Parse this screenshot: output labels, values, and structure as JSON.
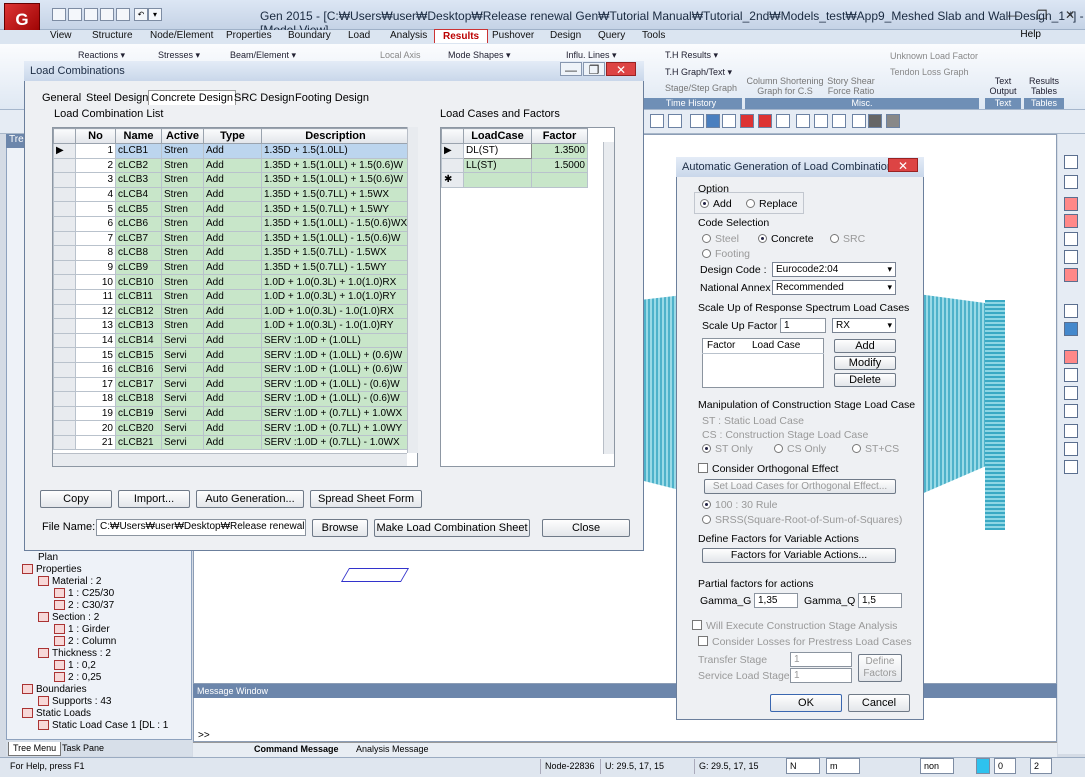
{
  "window": {
    "title": "Gen 2015 - [C:₩Users₩user₩Desktop₩Release renewal Gen₩Tutorial Manual₩Tutorial_2nd₩Models_test₩App9_Meshed Slab and Wall Design_1 *] - [Model View]",
    "logo": "G"
  },
  "menu": {
    "tabs": [
      "View",
      "Structure",
      "Node/Element",
      "Properties",
      "Boundary",
      "Load",
      "Analysis",
      "Results",
      "Pushover",
      "Design",
      "Query",
      "Tools"
    ],
    "active": "Results",
    "help": "Help"
  },
  "ribbon": {
    "reactions": "Reactions",
    "stresses": "Stresses",
    "beam_element": "Beam/Element",
    "local_axis": "Local Axis",
    "mode_shapes": "Mode Shapes",
    "influ_lines": "Influ. Lines",
    "th_results": "T.H Results",
    "th_graph": "T.H Graph/Text",
    "stage_step": "Stage/Step Graph",
    "time_history": "Time History",
    "column_shortening": "Column Shortening Graph for C.S",
    "story_shear": "Story Shear Force Ratio",
    "unknown_load": "Unknown Load Factor",
    "tendon_loss": "Tendon Loss Graph",
    "misc": "Misc.",
    "text_output": "Text Output",
    "text_group": "Text",
    "results_tables": "Results Tables",
    "tables_group": "Tables"
  },
  "tree": {
    "header": "Tree",
    "items": [
      {
        "label": "Plan",
        "indent": 2
      },
      {
        "label": "Properties",
        "indent": 1
      },
      {
        "label": "Material : 2",
        "indent": 2
      },
      {
        "label": "1 : C25/30",
        "indent": 3
      },
      {
        "label": "2 : C30/37",
        "indent": 3
      },
      {
        "label": "Section : 2",
        "indent": 2
      },
      {
        "label": "1 : Girder",
        "indent": 3
      },
      {
        "label": "2 : Column",
        "indent": 3
      },
      {
        "label": "Thickness : 2",
        "indent": 2
      },
      {
        "label": "1 : 0,2",
        "indent": 3
      },
      {
        "label": "2 : 0,25",
        "indent": 3
      },
      {
        "label": "Boundaries",
        "indent": 1
      },
      {
        "label": "Supports : 43",
        "indent": 2
      },
      {
        "label": "Static Loads",
        "indent": 1
      },
      {
        "label": "Static Load Case 1 [DL : 1",
        "indent": 2
      }
    ],
    "tabs": [
      "Tree Menu",
      "Task Pane"
    ]
  },
  "load_combinations": {
    "title": "Load Combinations",
    "tabs": [
      "General",
      "Steel Design",
      "Concrete Design",
      "SRC Design",
      "Footing Design"
    ],
    "active_tab": "Concrete Design",
    "list_label": "Load Combination List",
    "columns": [
      "No",
      "Name",
      "Active",
      "Type",
      "Description"
    ],
    "rows": [
      [
        "1",
        "cLCB1",
        "Stren",
        "Add",
        "1.35D + 1.5(1.0LL)"
      ],
      [
        "2",
        "cLCB2",
        "Stren",
        "Add",
        "1.35D + 1.5(1.0LL) + 1.5(0.6)W"
      ],
      [
        "3",
        "cLCB3",
        "Stren",
        "Add",
        "1.35D + 1.5(1.0LL) + 1.5(0.6)W"
      ],
      [
        "4",
        "cLCB4",
        "Stren",
        "Add",
        "1.35D + 1.5(0.7LL) + 1.5WX"
      ],
      [
        "5",
        "cLCB5",
        "Stren",
        "Add",
        "1.35D + 1.5(0.7LL) + 1.5WY"
      ],
      [
        "6",
        "cLCB6",
        "Stren",
        "Add",
        "1.35D + 1.5(1.0LL) - 1.5(0.6)WX"
      ],
      [
        "7",
        "cLCB7",
        "Stren",
        "Add",
        "1.35D + 1.5(1.0LL) - 1.5(0.6)W"
      ],
      [
        "8",
        "cLCB8",
        "Stren",
        "Add",
        "1.35D + 1.5(0.7LL) - 1.5WX"
      ],
      [
        "9",
        "cLCB9",
        "Stren",
        "Add",
        "1.35D + 1.5(0.7LL) - 1.5WY"
      ],
      [
        "10",
        "cLCB10",
        "Stren",
        "Add",
        "1.0D + 1.0(0.3L) + 1.0(1.0)RX"
      ],
      [
        "11",
        "cLCB11",
        "Stren",
        "Add",
        "1.0D + 1.0(0.3L) + 1.0(1.0)RY"
      ],
      [
        "12",
        "cLCB12",
        "Stren",
        "Add",
        "1.0D + 1.0(0.3L) - 1.0(1.0)RX"
      ],
      [
        "13",
        "cLCB13",
        "Stren",
        "Add",
        "1.0D + 1.0(0.3L) - 1.0(1.0)RY"
      ],
      [
        "14",
        "cLCB14",
        "Servi",
        "Add",
        "SERV :1.0D + (1.0LL)"
      ],
      [
        "15",
        "cLCB15",
        "Servi",
        "Add",
        "SERV :1.0D + (1.0LL) + (0.6)W"
      ],
      [
        "16",
        "cLCB16",
        "Servi",
        "Add",
        "SERV :1.0D + (1.0LL) + (0.6)W"
      ],
      [
        "17",
        "cLCB17",
        "Servi",
        "Add",
        "SERV :1.0D + (1.0LL) - (0.6)W"
      ],
      [
        "18",
        "cLCB18",
        "Servi",
        "Add",
        "SERV :1.0D + (1.0LL) - (0.6)W"
      ],
      [
        "19",
        "cLCB19",
        "Servi",
        "Add",
        "SERV :1.0D + (0.7LL) + 1.0WX"
      ],
      [
        "20",
        "cLCB20",
        "Servi",
        "Add",
        "SERV :1.0D + (0.7LL) + 1.0WY"
      ],
      [
        "21",
        "cLCB21",
        "Servi",
        "Add",
        "SERV :1.0D + (0.7LL) - 1.0WX"
      ]
    ],
    "cases_label": "Load Cases and Factors",
    "case_columns": [
      "LoadCase",
      "Factor"
    ],
    "cases": [
      [
        "DL(ST)",
        "1.3500"
      ],
      [
        "LL(ST)",
        "1.5000"
      ]
    ],
    "buttons": {
      "copy": "Copy",
      "import": "Import...",
      "auto": "Auto Generation...",
      "spread": "Spread Sheet Form",
      "browse": "Browse",
      "make": "Make Load Combination Sheet",
      "close": "Close"
    },
    "file_label": "File Name:",
    "file_value": "C:₩Users₩user₩Desktop₩Release renewal G"
  },
  "auto_gen": {
    "title": "Automatic Generation of Load Combinations",
    "option_label": "Option",
    "add": "Add",
    "replace": "Replace",
    "code_selection": "Code Selection",
    "steel": "Steel",
    "concrete": "Concrete",
    "src": "SRC",
    "footing": "Footing",
    "design_code_label": "Design Code :",
    "design_code": "Eurocode2:04",
    "national_annex_label": "National Annex :",
    "national_annex": "Recommended",
    "scale_up_label": "Scale Up of Response Spectrum Load Cases",
    "scale_factor_label": "Scale Up Factor :",
    "scale_factor": "1",
    "direction": "RX",
    "factor_col": "Factor",
    "loadcase_col": "Load Case",
    "add_btn": "Add",
    "modify_btn": "Modify",
    "delete_btn": "Delete",
    "manip_label": "Manipulation of Construction Stage Load Case",
    "st_text": "ST : Static Load Case",
    "cs_text": "CS : Construction Stage Load Case",
    "st_only": "ST Only",
    "cs_only": "CS Only",
    "st_cs": "ST+CS",
    "orth_label": "Consider Orthogonal Effect",
    "orth_btn": "Set Load Cases for Orthogonal Effect...",
    "rule_100": "100 : 30 Rule",
    "srss": "SRSS(Square-Root-of-Sum-of-Squares)",
    "variable_label": "Define Factors for Variable Actions",
    "variable_btn": "Factors for Variable Actions...",
    "partial_label": "Partial factors for actions",
    "gamma_g_label": "Gamma_G :",
    "gamma_g": "1,35",
    "gamma_q_label": "Gamma_Q :",
    "gamma_q": "1,5",
    "will_exec": "Will Execute Construction Stage Analysis",
    "consider_losses": "Consider Losses for Prestress Load Cases",
    "transfer_stage": "Transfer Stage",
    "service_stage": "Service Load Stage",
    "stage_val1": "1",
    "stage_val2": "1",
    "define_factors": "Define Factors",
    "ok": "OK",
    "cancel": "Cancel"
  },
  "message": {
    "header": "Message Window",
    "prompt": ">>",
    "tabs": [
      "Command Message",
      "Analysis Message"
    ]
  },
  "status": {
    "help": "For Help, press F1",
    "node": "Node-22836",
    "u": "U: 29.5, 17, 15",
    "g": "G: 29.5, 17, 15",
    "unit_force": "N",
    "unit_length": "m",
    "none": "non",
    "page": "0",
    "total": "2"
  }
}
